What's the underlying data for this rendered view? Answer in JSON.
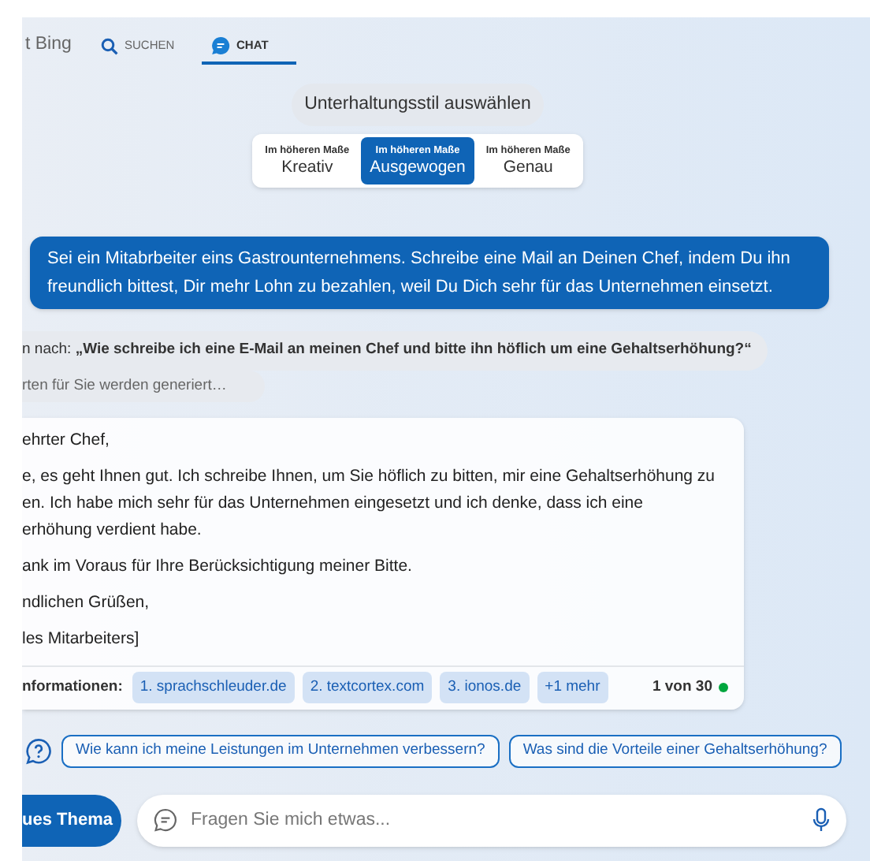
{
  "tabs": [
    {
      "label": "t Bing",
      "kind": "text",
      "selected": false
    },
    {
      "label": "SUCHEN",
      "kind": "search",
      "selected": false
    },
    {
      "label": "CHAT",
      "kind": "chat",
      "selected": true
    }
  ],
  "style_picker": {
    "title": "Unterhaltungsstil auswählen",
    "options": [
      {
        "caption": "Im höheren Maße",
        "label": "Kreativ",
        "selected": false
      },
      {
        "caption": "Im höheren Maße",
        "label": "Ausgewogen",
        "selected": true
      },
      {
        "caption": "Im höheren Maße",
        "label": "Genau",
        "selected": false
      }
    ]
  },
  "user_message": "Sei ein Mitabrbeiter eins Gastrounternehmens. Schreibe eine Mail an Deinen Chef, indem Du ihn freundlich bittest, Dir mehr Lohn zu bezahlen, weil Du Dich sehr für das Unternehmen einsetzt.",
  "search_status": "n nach: **„Wie schreibe ich eine E-Mail an meinen Chef und bitte ihn höflich um eine Gehaltserhöhung?“**",
  "generating": "rten für Sie werden generiert…",
  "answer": {
    "paragraphs": [
      {
        "lines": [
          "ehrter Chef,"
        ]
      },
      {
        "lines": [
          "e, es geht Ihnen gut. Ich schreibe Ihnen, um Sie höflich zu bitten, mir eine Gehaltserhöhung zu",
          "en. Ich habe mich sehr für das Unternehmen eingesetzt und ich denke, dass ich eine",
          "erhöhung verdient habe."
        ]
      },
      {
        "lines": [
          "ank im Voraus für Ihre Berücksichtigung meiner Bitte."
        ]
      },
      {
        "lines": [
          "ndlichen Grüßen,"
        ]
      },
      {
        "lines": [
          "les Mitarbeiters]"
        ]
      }
    ],
    "sources_label": "nformationen:",
    "sources": [
      "1. sprachschleuder.de",
      "2. textcortex.com",
      "3. ionos.de",
      "+1 mehr"
    ],
    "counter": "1 von 30"
  },
  "suggestions": [
    "Wie kann ich meine Leistungen im Unternehmen verbessern?",
    "Was sind die Vorteile einer Gehaltserhöhung?"
  ],
  "new_topic_button": "ues Thema",
  "input": {
    "placeholder": "Fragen Sie mich etwas..."
  }
}
